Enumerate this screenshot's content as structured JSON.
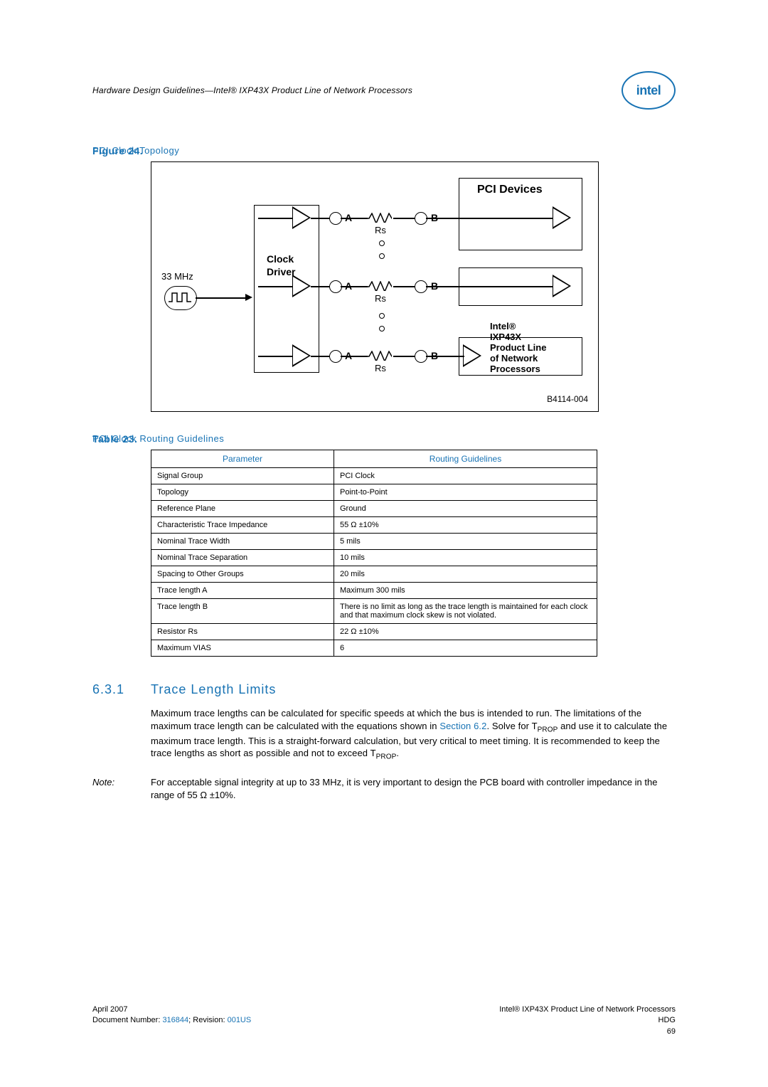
{
  "header": {
    "text": "Hardware Design Guidelines—Intel® IXP43X Product Line of Network Processors",
    "logo": "intel"
  },
  "figure": {
    "label": "Figure 24.",
    "title": "PCI Clock Topology",
    "pci_devices": "PCI Devices",
    "clock_driver_l1": "Clock",
    "clock_driver_l2": "Driver",
    "freq": "33 MHz",
    "A": "A",
    "B": "B",
    "Rs": "Rs",
    "chip_l1": "Intel®",
    "chip_l2": "IXP43X",
    "chip_l3": "Product Line",
    "chip_l4": "of Network",
    "chip_l5": "Processors",
    "code": "B4114-004"
  },
  "table": {
    "label": "Table 23.",
    "title": "PCI Clock Routing Guidelines",
    "headers": {
      "param": "Parameter",
      "guideline": "Routing Guidelines"
    },
    "rows": [
      {
        "p": "Signal Group",
        "g": "PCI Clock"
      },
      {
        "p": "Topology",
        "g": "Point-to-Point"
      },
      {
        "p": "Reference Plane",
        "g": "Ground"
      },
      {
        "p": "Characteristic Trace Impedance",
        "g": "55 Ω ±10%"
      },
      {
        "p": "Nominal Trace Width",
        "g": "5 mils"
      },
      {
        "p": "Nominal Trace Separation",
        "g": "10 mils"
      },
      {
        "p": "Spacing to Other Groups",
        "g": "20 mils"
      },
      {
        "p": "Trace length A",
        "g": "Maximum 300 mils"
      },
      {
        "p": "Trace length B",
        "g": "There is no limit as long as the trace length is maintained for each clock and that maximum clock skew is not violated."
      },
      {
        "p": "Resistor Rs",
        "g": "22 Ω ±10%"
      },
      {
        "p": "Maximum VIAS",
        "g": "6"
      }
    ]
  },
  "section": {
    "num": "6.3.1",
    "title": "Trace Length Limits",
    "para_1a": "Maximum trace lengths can be calculated for specific speeds at which the bus is intended to run. The limitations of the maximum trace length can be calculated with the equations shown in ",
    "para_1_link": "Section 6.2",
    "para_1b": ". Solve for T",
    "para_1_sub": "PROP",
    "para_1c": " and use it to calculate the maximum trace length. This is a straight-forward calculation, but very critical to meet timing. It is recommended to keep the trace lengths as short as possible and not to exceed T",
    "para_1_sub2": "PROP",
    "para_1d": ".",
    "note_label": "Note:",
    "note_body": "For acceptable signal integrity at up to 33 MHz, it is very important to design the PCB board with controller impedance in the range of 55 Ω ±10%."
  },
  "footer": {
    "left_l1": "April 2007",
    "left_l2a": "Document Number: ",
    "left_doc": "316844",
    "left_l2b": "; Revision: ",
    "left_rev": "001US",
    "right_l1": "Intel® IXP43X Product Line of Network Processors",
    "right_l2": "HDG",
    "right_l3": "69"
  }
}
